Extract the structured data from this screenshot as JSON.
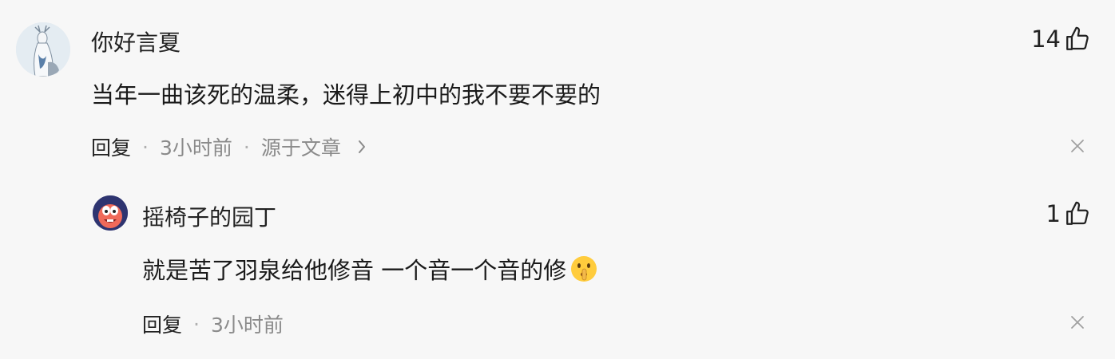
{
  "main_comment": {
    "username": "你好言夏",
    "likes": "14",
    "content": "当年一曲该死的温柔，迷得上初中的我不要不要的",
    "reply_label": "回复",
    "time": "3小时前",
    "source": "源于文章",
    "avatar_icon": "deer-avatar-icon"
  },
  "reply_comment": {
    "username": "摇椅子的园丁",
    "likes": "1",
    "content": "就是苦了羽泉给他修音 一个音一个音的修",
    "emoji": "shushing-face-icon",
    "reply_label": "回复",
    "time": "3小时前",
    "avatar_icon": "cartoon-avatar-icon"
  },
  "separator": "·",
  "colors": {
    "background": "#f7f7f7",
    "text": "#222222",
    "muted": "#8a8a8a"
  }
}
